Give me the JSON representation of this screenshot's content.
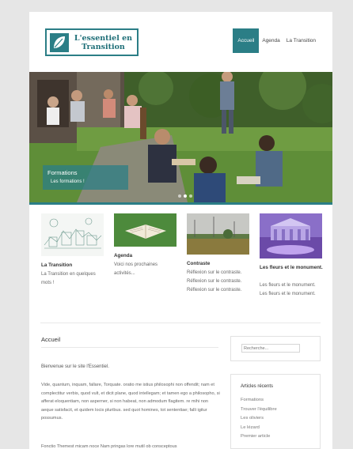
{
  "header": {
    "logo_line1": "L'essentiel en",
    "logo_line2": "Transition",
    "nav": [
      "Accueil",
      "Agenda",
      "La Transition"
    ],
    "nav_active": "Accueil"
  },
  "slider": {
    "caption_title": "Formations",
    "caption_text": "Les formations !",
    "slide_count": 3,
    "active_slide": 2
  },
  "thumbnails": [
    {
      "title": "La Transition",
      "desc": "La Transition en quelques mots !"
    },
    {
      "title": "Agenda",
      "desc": "Voici nos prochaines activités..."
    },
    {
      "title": "Contraste",
      "desc": "Réflexion sur le contraste. Réflexion sur le contraste. Réflexion sur le contraste."
    },
    {
      "title": "Les fleurs et le monument.",
      "desc": "Les fleurs et le monument. Les fleurs et le monument."
    }
  ],
  "main": {
    "title": "Accueil",
    "intro": "Bienvenue sur le site l'Essentiel.",
    "body": "Vide, quantum, inquam, fallare, Torquate. oratio me istius philosophi non offendit; nam et complectitur verbis, quod vult, et dicit plane, quod intellegam; et tamen ego a philosopho, si afferat eloquentiam, non asperner, si non habeat, non admodum flagitem. re mihi non aeque satisfacit, et quidem locis pluribus. sed quot homines, tot sententiae; falli igitur possumus.",
    "body2": "Fonctio Themest micam noce Nam pringas lore mutil ob consceptous"
  },
  "sidebar": {
    "search_placeholder": "Recherche...",
    "recent_title": "Articles récents",
    "recent_items": [
      "Formations",
      "Trouver l'équilibre",
      "Les oliviers",
      "Le lézard",
      "Premier article"
    ]
  },
  "colors": {
    "accent": "#2b7e86",
    "page_bg": "#e6e6e6"
  }
}
